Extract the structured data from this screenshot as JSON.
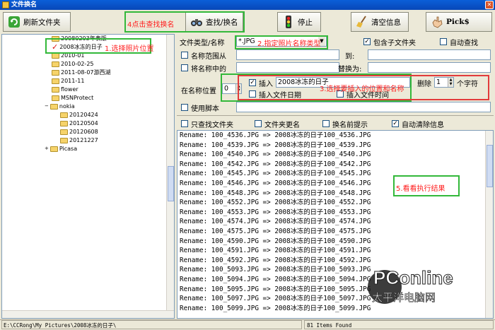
{
  "window": {
    "title": "文件换名"
  },
  "toolbar": {
    "refresh_label": "刷新文件夹",
    "find_replace_label": "查找/换名",
    "stop_label": "停止",
    "clear_label": "清空信息",
    "picks_label": "Pick$"
  },
  "annotations": {
    "step1": "1.选择照片位置",
    "step2": "2.指定照片名称类型",
    "step3": "3.选择要插入的位置和名称",
    "step4": "4点击查找换名",
    "step5": "5.看看执行结果"
  },
  "tree": {
    "items": [
      {
        "label": "20080203年表版",
        "level": 1
      },
      {
        "label": "2008冰冻的日子",
        "level": 1,
        "checked": true
      },
      {
        "label": "2010-01",
        "level": 1
      },
      {
        "label": "2010-02-25",
        "level": 1
      },
      {
        "label": "2011-08-07游西湖",
        "level": 1
      },
      {
        "label": "2011-11",
        "level": 1
      },
      {
        "label": "flower",
        "level": 1
      },
      {
        "label": "MSNProtect",
        "level": 1
      },
      {
        "label": "nokia",
        "level": 1
      },
      {
        "label": "20120424",
        "level": 2
      },
      {
        "label": "20120504",
        "level": 2
      },
      {
        "label": "20120608",
        "level": 2
      },
      {
        "label": "20121227",
        "level": 2
      },
      {
        "label": "Picasa",
        "level": 1
      }
    ]
  },
  "form": {
    "file_type_label": "文件类型/名称",
    "file_type_value": "*.JPG",
    "include_subfolders_label": "包含子文件夹",
    "include_subfolders_checked": true,
    "auto_find_label": "自动查找",
    "auto_find_checked": false,
    "name_range_label": "名称范围从",
    "to_label": "到:",
    "replace_in_name_label": "将名称中的",
    "replace_with_label": "替换为:",
    "position_label": "在名称位置",
    "position_value": "0",
    "insert_label": "插入",
    "insert_checked": true,
    "insert_value": "2008冰冻的日子",
    "delete_label": "删除",
    "delete_value": "1",
    "chars_label": "个字符",
    "insert_date_label": "插入文件日期",
    "insert_time_label": "插入文件时间",
    "use_script_label": "使用脚本",
    "only_folders_label": "只查找文件夹",
    "folder_rename_label": "文件夹更名",
    "prompt_before_label": "换名前提示",
    "auto_clear_label": "自动清除信息",
    "auto_clear_checked": true
  },
  "log": {
    "lines": [
      "Rename: 100_4536.JPG => 2008冰冻的日子100_4536.JPG",
      "Rename: 100_4539.JPG => 2008冰冻的日子100_4539.JPG",
      "Rename: 100_4540.JPG => 2008冰冻的日子100_4540.JPG",
      "Rename: 100_4542.JPG => 2008冰冻的日子100_4542.JPG",
      "Rename: 100_4545.JPG => 2008冰冻的日子100_4545.JPG",
      "Rename: 100_4546.JPG => 2008冰冻的日子100_4546.JPG",
      "Rename: 100_4548.JPG => 2008冰冻的日子100_4548.JPG",
      "Rename: 100_4552.JPG => 2008冰冻的日子100_4552.JPG",
      "Rename: 100_4553.JPG => 2008冰冻的日子100_4553.JPG",
      "Rename: 100_4574.JPG => 2008冰冻的日子100_4574.JPG",
      "Rename: 100_4575.JPG => 2008冰冻的日子100_4575.JPG",
      "Rename: 100_4590.JPG => 2008冰冻的日子100_4590.JPG",
      "Rename: 100_4591.JPG => 2008冰冻的日子100_4591.JPG",
      "Rename: 100_4592.JPG => 2008冰冻的日子100_4592.JPG",
      "Rename: 100_5093.JPG => 2008冰冻的日子100_5093.JPG",
      "Rename: 100_5094.JPG => 2008冰冻的日子100_5094.JPG",
      "Rename: 100_5095.JPG => 2008冰冻的日子100_5095.JPG",
      "Rename: 100_5097.JPG => 2008冰冻的日子100_5097.JPG",
      "Rename: 100_5099.JPG => 2008冰冻的日子100_5099.JPG"
    ]
  },
  "status": {
    "path": "E:\\CCRong\\My Pictures\\2008冰冻的日子\\",
    "count": "81 Items Found"
  },
  "watermark": {
    "brand": "PConline",
    "brand_suffix": ".com.cn",
    "slogan": "太平洋电脑网"
  },
  "colors": {
    "annotation_red": "#ff1f1f",
    "highlight_green": "#33b83a"
  }
}
